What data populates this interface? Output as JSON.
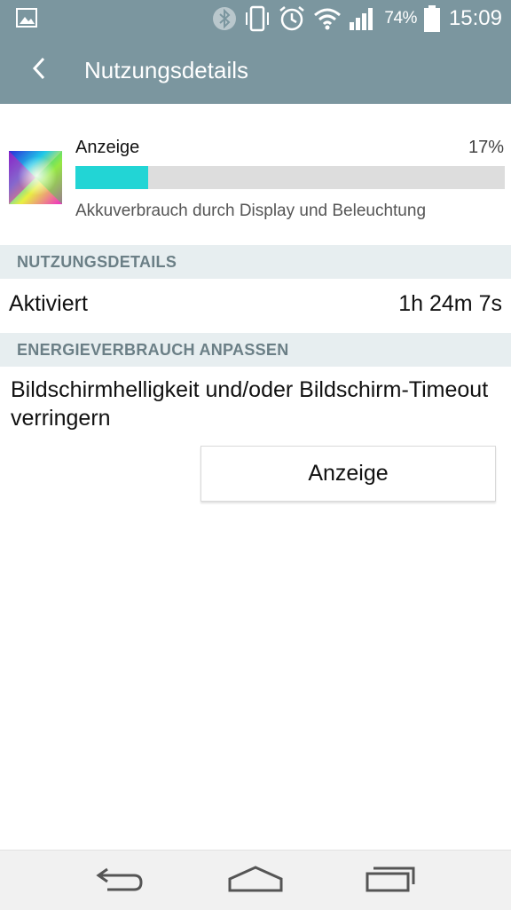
{
  "status_bar": {
    "battery_percent": "74%",
    "time": "15:09",
    "icons": [
      "gallery-icon",
      "bluetooth-icon",
      "vibrate-icon",
      "alarm-icon",
      "wifi-icon",
      "signal-icon",
      "battery-icon"
    ]
  },
  "header": {
    "title": "Nutzungsdetails",
    "back_icon": "chevron-left-icon"
  },
  "app_usage": {
    "name": "Anzeige",
    "percent": "17%",
    "progress": 0.17,
    "description": "Akkuverbrauch durch Display und Beleuchtung"
  },
  "sections": {
    "usage_details_header": "NUTZUNGSDETAILS",
    "energy_header": "ENERGIEVERBRAUCH ANPASSEN"
  },
  "usage_details": {
    "label": "Aktiviert",
    "value": "1h 24m 7s"
  },
  "energy": {
    "advice": "Bildschirmhelligkeit und/oder Bildschirm-Timeout verringern",
    "button_label": "Anzeige"
  },
  "nav_bar": {
    "icons": [
      "back-icon",
      "home-icon",
      "recent-apps-icon"
    ]
  },
  "colors": {
    "header_bg": "#7b969f",
    "accent": "#22d5d5",
    "section_bg": "#e7eef0"
  }
}
